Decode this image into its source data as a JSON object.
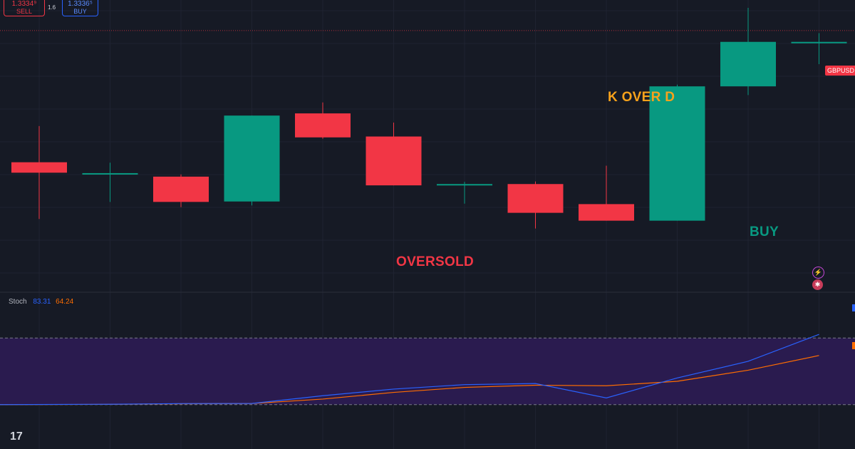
{
  "trade_panel": {
    "sell_price": "1.3334⁹",
    "sell_label": "SELL",
    "spread": "1.6",
    "buy_price": "1.3336⁵",
    "buy_label": "BUY"
  },
  "symbol": "GBPUSD",
  "indicator": {
    "name": "Stoch",
    "k_value": "83.31",
    "d_value": "64.24"
  },
  "annotations": {
    "k_over_d": "K OVER D",
    "oversold": "OVERSOLD",
    "buy": "BUY"
  },
  "colors": {
    "bull": "#089981",
    "bear": "#f23645",
    "k_line": "#2962ff",
    "d_line": "#ff6d00",
    "band_fill": "#2a1b4f",
    "annot_orange": "#f7a21b",
    "annot_red": "#f23645",
    "annot_teal": "#089981"
  },
  "chart_data": {
    "type": "candlestick",
    "price_range": [
      1.3285,
      1.3352
    ],
    "last_price": 1.3345,
    "candles": [
      {
        "o": 1.33148,
        "h": 1.33231,
        "l": 1.33018,
        "c": 1.33124
      },
      {
        "o": 1.3312,
        "h": 1.33147,
        "l": 1.33057,
        "c": 1.33123
      },
      {
        "o": 1.33115,
        "h": 1.3312,
        "l": 1.33045,
        "c": 1.33057
      },
      {
        "o": 1.33058,
        "h": 1.33255,
        "l": 1.33049,
        "c": 1.33255
      },
      {
        "o": 1.3326,
        "h": 1.33285,
        "l": 1.33202,
        "c": 1.33205
      },
      {
        "o": 1.33207,
        "h": 1.33239,
        "l": 1.33095,
        "c": 1.33095
      },
      {
        "o": 1.33095,
        "h": 1.33103,
        "l": 1.33053,
        "c": 1.33098
      },
      {
        "o": 1.33098,
        "h": 1.33104,
        "l": 1.32996,
        "c": 1.33032
      },
      {
        "o": 1.33052,
        "h": 1.3314,
        "l": 1.33014,
        "c": 1.33014
      },
      {
        "o": 1.33014,
        "h": 1.33326,
        "l": 1.33014,
        "c": 1.33322
      },
      {
        "o": 1.33322,
        "h": 1.33502,
        "l": 1.33302,
        "c": 1.33424
      },
      {
        "o": 1.33424,
        "h": 1.33444,
        "l": 1.33373,
        "c": 1.33424
      }
    ],
    "stoch": {
      "range": [
        0,
        100
      ],
      "levels": [
        80,
        20
      ],
      "k": [
        20.0,
        20.3,
        20.9,
        21.0,
        28.0,
        34.0,
        38.0,
        39.0,
        26.0,
        44.0,
        59.0,
        83.31
      ],
      "d": [
        20.0,
        20.2,
        20.8,
        21.0,
        25.0,
        31.0,
        35.5,
        37.5,
        37.0,
        41.0,
        51.0,
        64.24
      ]
    }
  }
}
